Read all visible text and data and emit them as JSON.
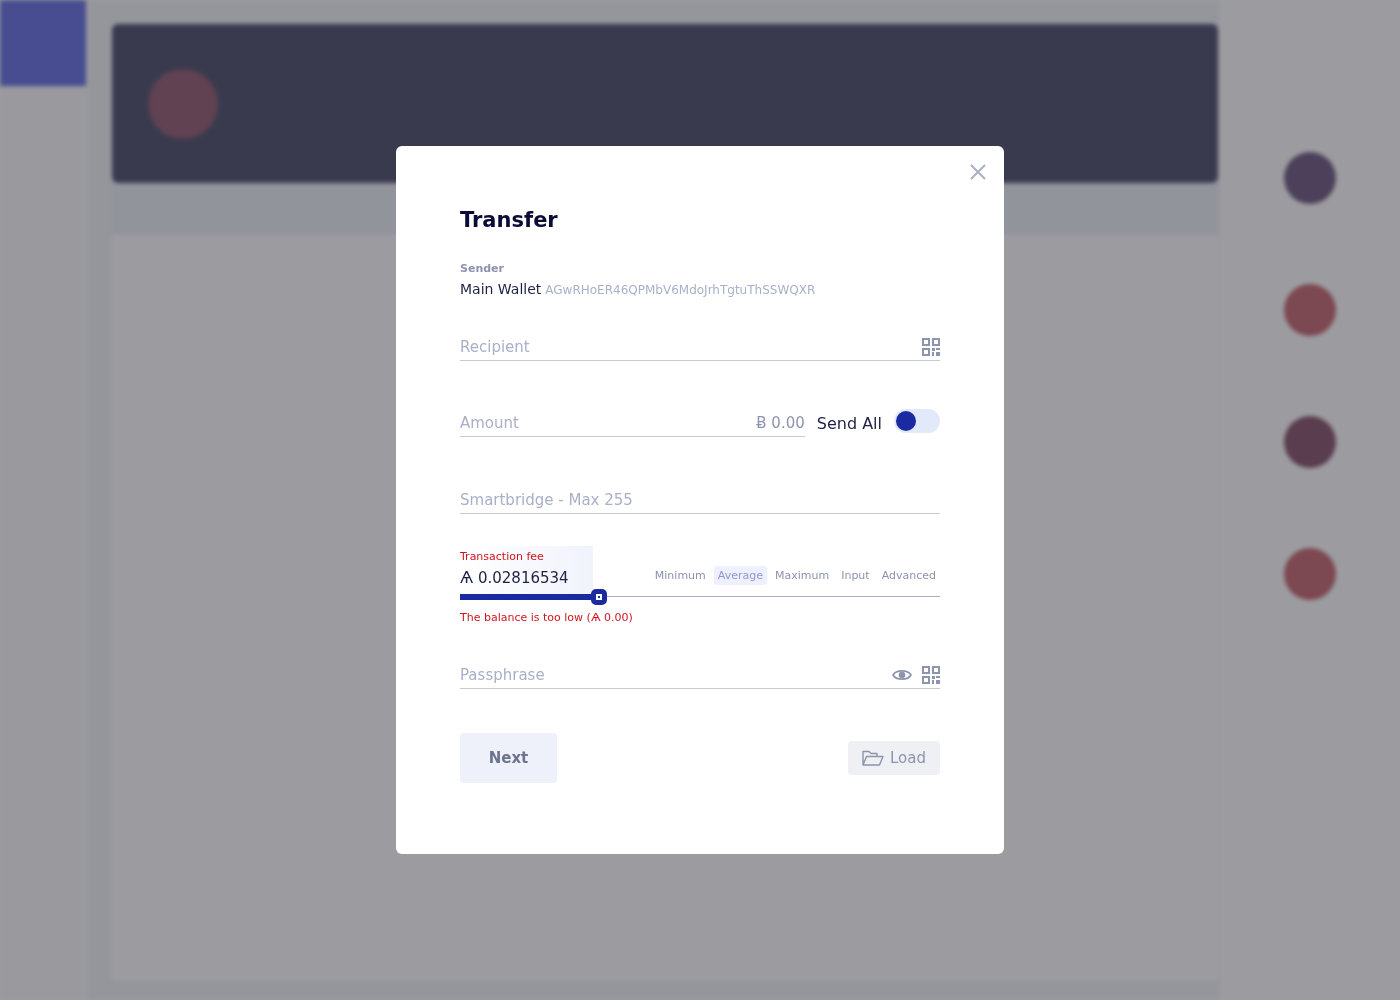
{
  "modal": {
    "title": "Transfer",
    "sender": {
      "label": "Sender",
      "name": "Main Wallet",
      "address": "AGwRHoER46QPMbV6MdoJrhTgtuThSSWQXR"
    },
    "recipient": {
      "placeholder": "Recipient"
    },
    "amount": {
      "placeholder": "Amount",
      "balance": "Ƀ 0.00"
    },
    "send_all": {
      "label": "Send All",
      "on": false
    },
    "smartbridge": {
      "placeholder": "Smartbridge - Max 255"
    },
    "fee": {
      "label": "Transaction fee",
      "value": "Ѧ 0.02816534",
      "level": 0.29,
      "error": "The balance is too low (Ѧ 0.00)",
      "options": [
        {
          "label": "Minimum",
          "selected": false
        },
        {
          "label": "Average",
          "selected": true
        },
        {
          "label": "Maximum",
          "selected": false
        },
        {
          "label": "Input",
          "selected": false
        },
        {
          "label": "Advanced",
          "selected": false
        }
      ]
    },
    "passphrase": {
      "placeholder": "Passphrase"
    },
    "buttons": {
      "next": "Next",
      "load": "Load"
    }
  }
}
